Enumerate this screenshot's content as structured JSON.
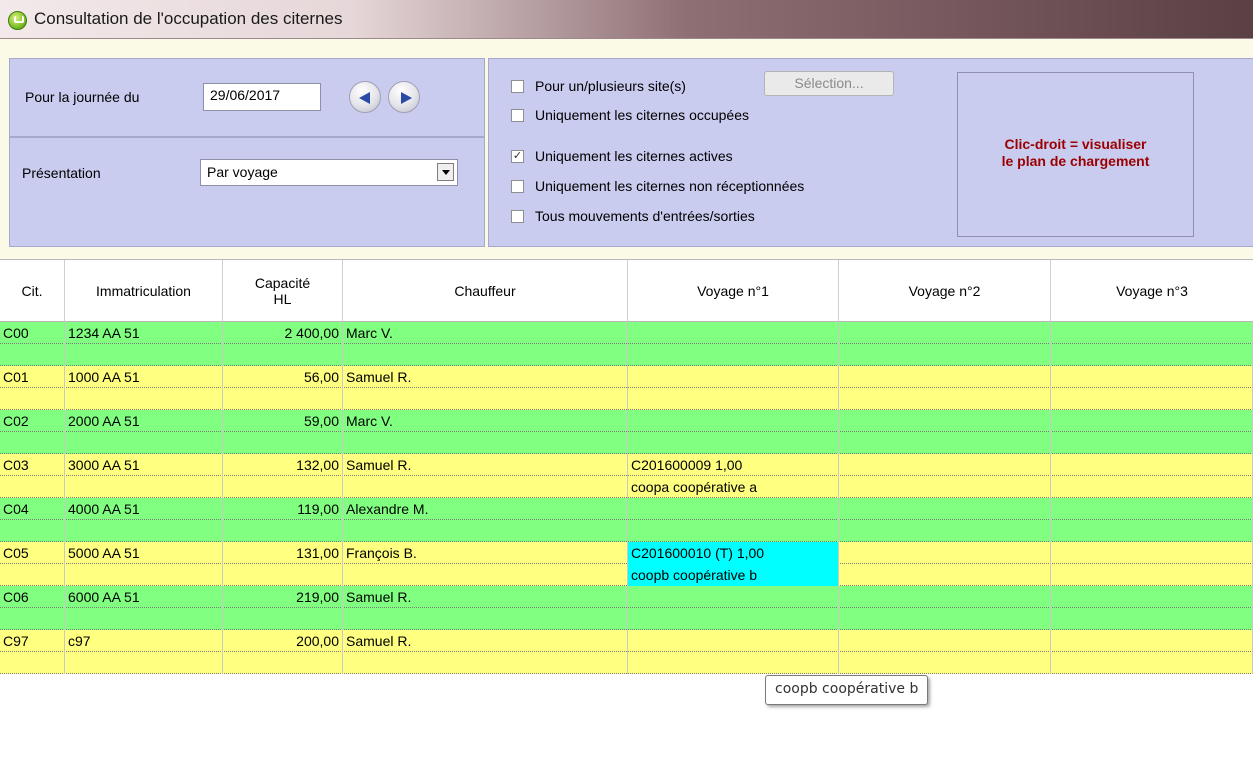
{
  "window": {
    "title": "Consultation de l'occupation des citernes"
  },
  "date_panel": {
    "label": "Pour la journée du",
    "date_value": "29/06/2017"
  },
  "presentation_panel": {
    "label": "Présentation",
    "value": "Par voyage"
  },
  "filters": {
    "sites": {
      "label": "Pour un/plusieurs site(s)",
      "checked": false
    },
    "selection_button": "Sélection...",
    "occupied": {
      "label": "Uniquement les citernes occupées",
      "checked": false
    },
    "active": {
      "label": "Uniquement les citernes actives",
      "checked": true
    },
    "not_received": {
      "label": "Uniquement les citernes non réceptionnées",
      "checked": false
    },
    "all_moves": {
      "label": "Tous mouvements d'entrées/sorties",
      "checked": false
    }
  },
  "info": {
    "line1": "Clic-droit = visualiser",
    "line2": "le plan de chargement"
  },
  "grid": {
    "headers": {
      "cit": "Cit.",
      "immat": "Immatriculation",
      "cap1": "Capacité",
      "cap2": "HL",
      "chauffeur": "Chauffeur",
      "v1": "Voyage n°1",
      "v2": "Voyage n°2",
      "v3": "Voyage n°3"
    },
    "rows": [
      {
        "cit": "C00",
        "immat": "1234 AA 51",
        "cap": "2 400,00",
        "chauffeur": "Marc V.",
        "v1a": "",
        "v1b": ""
      },
      {
        "cit": "C01",
        "immat": "1000 AA 51",
        "cap": "56,00",
        "chauffeur": "Samuel R.",
        "v1a": "",
        "v1b": ""
      },
      {
        "cit": "C02",
        "immat": "2000 AA 51",
        "cap": "59,00",
        "chauffeur": "Marc V.",
        "v1a": "",
        "v1b": ""
      },
      {
        "cit": "C03",
        "immat": "3000 AA 51",
        "cap": "132,00",
        "chauffeur": "Samuel R.",
        "v1a": "C201600009 1,00",
        "v1b": "coopa coopérative a"
      },
      {
        "cit": "C04",
        "immat": "4000 AA 51",
        "cap": "119,00",
        "chauffeur": "Alexandre M.",
        "v1a": "",
        "v1b": ""
      },
      {
        "cit": "C05",
        "immat": "5000 AA 51",
        "cap": "131,00",
        "chauffeur": "François B.",
        "v1a": "C201600010 (T) 1,00",
        "v1b": "coopb coopérative b"
      },
      {
        "cit": "C06",
        "immat": "6000 AA 51",
        "cap": "219,00",
        "chauffeur": "Samuel R.",
        "v1a": "",
        "v1b": ""
      },
      {
        "cit": "C97",
        "immat": "c97",
        "cap": "200,00",
        "chauffeur": "Samuel R.",
        "v1a": "",
        "v1b": ""
      }
    ]
  },
  "tooltip": {
    "text": "coopb coopérative b"
  }
}
